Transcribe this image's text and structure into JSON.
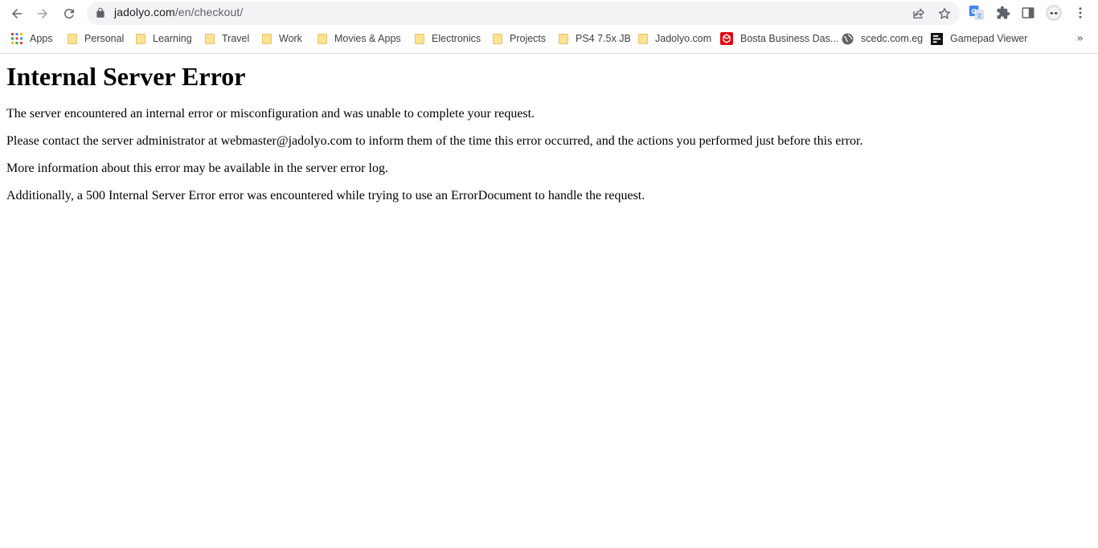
{
  "browser": {
    "url_domain": "jadolyo.com",
    "url_path": "/en/checkout/",
    "bookmarks": [
      {
        "label": "Apps",
        "icon": "apps-grid-icon"
      },
      {
        "label": "Personal",
        "icon": "folder-icon"
      },
      {
        "label": "Learning",
        "icon": "folder-icon"
      },
      {
        "label": "Travel",
        "icon": "folder-icon"
      },
      {
        "label": "Work",
        "icon": "folder-icon"
      },
      {
        "label": "Movies & Apps",
        "icon": "folder-icon"
      },
      {
        "label": "Electronics",
        "icon": "folder-icon"
      },
      {
        "label": "Projects",
        "icon": "folder-icon"
      },
      {
        "label": "PS4 7.5x JB",
        "icon": "folder-icon"
      },
      {
        "label": "Jadolyo.com",
        "icon": "folder-icon"
      },
      {
        "label": "Bosta Business Das...",
        "icon": "bosta-icon"
      },
      {
        "label": "scedc.com.eg",
        "icon": "globe-icon"
      },
      {
        "label": "Gamepad Viewer",
        "icon": "gamepad-viewer-icon"
      }
    ],
    "overflow_glyph": "»"
  },
  "page": {
    "title": "Internal Server Error",
    "paragraphs": [
      "The server encountered an internal error or misconfiguration and was unable to complete your request.",
      "Please contact the server administrator at webmaster@jadolyo.com to inform them of the time this error occurred, and the actions you performed just before this error.",
      "More information about this error may be available in the server error log.",
      "Additionally, a 500 Internal Server Error error was encountered while trying to use an ErrorDocument to handle the request."
    ]
  },
  "colors": {
    "omnibox_bg": "#f1f3f4",
    "folder": "#fde293",
    "icon_gray": "#5f6368",
    "bosta_red": "#e30613"
  }
}
